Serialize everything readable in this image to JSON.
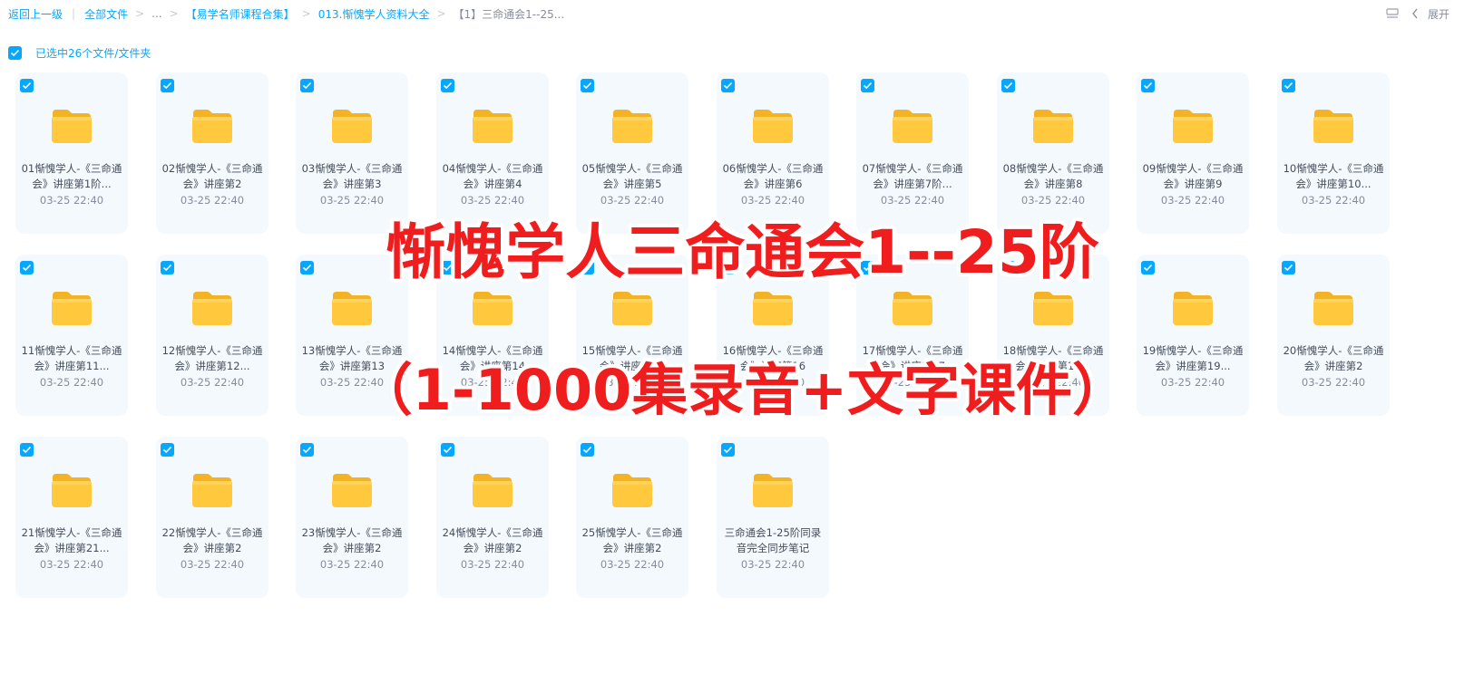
{
  "breadcrumb": {
    "back": "返回上一级",
    "all_files": "全部文件",
    "ellipsis": "...",
    "level1": "【易学名师课程合集】",
    "level2": "013.惭愧学人资料大全",
    "current": "【1】三命通会1--25..."
  },
  "top_right": {
    "expand_label": "展开"
  },
  "selection": {
    "text": "已选中26个文件/文件夹"
  },
  "files": [
    {
      "name": "01惭愧学人-《三命通会》讲座第1阶...",
      "date": "03-25 22:40"
    },
    {
      "name": "02惭愧学人-《三命通会》讲座第2",
      "date": "03-25 22:40"
    },
    {
      "name": "03惭愧学人-《三命通会》讲座第3",
      "date": "03-25 22:40"
    },
    {
      "name": "04惭愧学人-《三命通会》讲座第4",
      "date": "03-25 22:40"
    },
    {
      "name": "05惭愧学人-《三命通会》讲座第5",
      "date": "03-25 22:40"
    },
    {
      "name": "06惭愧学人-《三命通会》讲座第6",
      "date": "03-25 22:40"
    },
    {
      "name": "07惭愧学人-《三命通会》讲座第7阶...",
      "date": "03-25 22:40"
    },
    {
      "name": "08惭愧学人-《三命通会》讲座第8",
      "date": "03-25 22:40"
    },
    {
      "name": "09惭愧学人-《三命通会》讲座第9",
      "date": "03-25 22:40"
    },
    {
      "name": "10惭愧学人-《三命通会》讲座第10...",
      "date": "03-25 22:40"
    },
    {
      "name": "11惭愧学人-《三命通会》讲座第11...",
      "date": "03-25 22:40"
    },
    {
      "name": "12惭愧学人-《三命通会》讲座第12...",
      "date": "03-25 22:40"
    },
    {
      "name": "13惭愧学人-《三命通会》讲座第13",
      "date": "03-25 22:40"
    },
    {
      "name": "14惭愧学人-《三命通会》讲座第14",
      "date": "03-25 22:40"
    },
    {
      "name": "15惭愧学人-《三命通会》讲座第15",
      "date": "03-25 22:40"
    },
    {
      "name": "16惭愧学人-《三命通会》讲座第16",
      "date": "03-25 22:40"
    },
    {
      "name": "17惭愧学人-《三命通会》讲座第17",
      "date": "03-25 22:40"
    },
    {
      "name": "18惭愧学人-《三命通会》讲座第18...",
      "date": "03-25 22:40"
    },
    {
      "name": "19惭愧学人-《三命通会》讲座第19...",
      "date": "03-25 22:40"
    },
    {
      "name": "20惭愧学人-《三命通会》讲座第2",
      "date": "03-25 22:40"
    },
    {
      "name": "21惭愧学人-《三命通会》讲座第21...",
      "date": "03-25 22:40"
    },
    {
      "name": "22惭愧学人-《三命通会》讲座第2",
      "date": "03-25 22:40"
    },
    {
      "name": "23惭愧学人-《三命通会》讲座第2",
      "date": "03-25 22:40"
    },
    {
      "name": "24惭愧学人-《三命通会》讲座第2",
      "date": "03-25 22:40"
    },
    {
      "name": "25惭愧学人-《三命通会》讲座第2",
      "date": "03-25 22:40"
    },
    {
      "name": "三命通会1-25阶同录音完全同步笔记",
      "date": "03-25 22:40"
    }
  ],
  "overlay": {
    "line1": "惭愧学人三命通会1--25阶",
    "line2": "（1-1000集录音+文字课件）"
  },
  "colors": {
    "accent": "#06a7ff",
    "card_bg": "#f4f9fe",
    "folder": "#ffc83d",
    "overlay_text": "#ef1d1d"
  },
  "icons": {
    "checkbox": "checkbox-checked-icon",
    "folder": "folder-icon",
    "view": "list-view-icon",
    "chevron": "chevron-left-icon"
  }
}
